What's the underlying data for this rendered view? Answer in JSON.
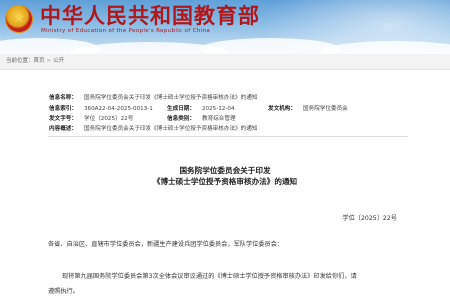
{
  "header": {
    "title": "中华人民共和国教育部",
    "subtitle": "Ministry of Education of the People's Republic of China"
  },
  "breadcrumb": {
    "current_label": "当前位置：",
    "home": "首页",
    "section": "公开"
  },
  "meta": {
    "info_name_label": "信息名称：",
    "info_name": "国务院学位委员会关于印发《博士硕士学位授予资格审核办法》的通知",
    "index_label": "信息索引：",
    "index": "360A22-04-2025-0013-1",
    "date_label": "生成日期：",
    "date": "2025-12-04",
    "org_label": "发文机构：",
    "org": "国务院学位委员会",
    "doc_no_label": "发文字号：",
    "doc_no": "学位〔2025〕22号",
    "category_label": "信息类别：",
    "category": "教育综合管理",
    "summary_label": "内容概述：",
    "summary": "国务院学位委员会关于印发《博士硕士学位授予资格审核办法》的通知"
  },
  "document": {
    "title_line1": "国务院学位委员会关于印发",
    "title_line2": "《博士硕士学位授予资格审核办法》的通知",
    "doc_no": "学位〔2025〕22号",
    "salutation": "各省、自治区、直辖市学位委员会，新疆生产建设兵团学位委员会，军队学位委员会：",
    "body_line1": "现将第九届国务院学位委员会第3次全体会议审议通过的《博士硕士学位授予资格审核办法》印发给你们，请",
    "body_line2": "遵照执行。"
  },
  "colors": {
    "brand_red": "#b0171b",
    "header_blue": "#5f9fd8"
  }
}
